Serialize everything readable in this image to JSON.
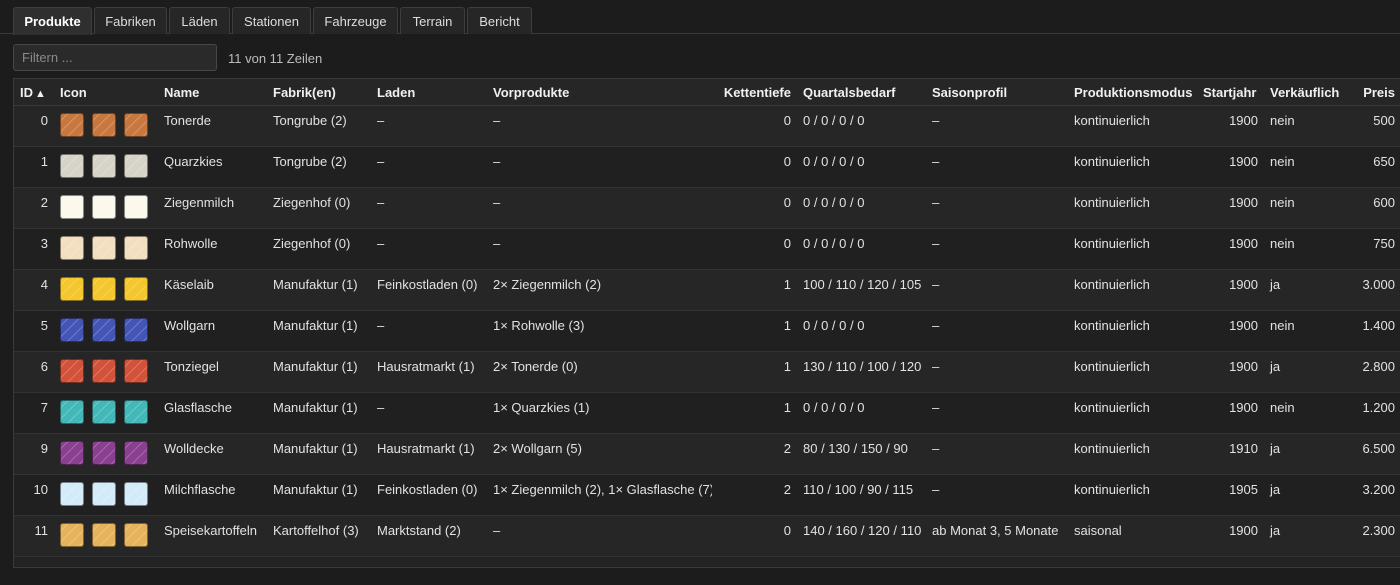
{
  "tabs": [
    {
      "label": "Produkte",
      "active": true
    },
    {
      "label": "Fabriken",
      "active": false
    },
    {
      "label": "Läden",
      "active": false
    },
    {
      "label": "Stationen",
      "active": false
    },
    {
      "label": "Fahrzeuge",
      "active": false
    },
    {
      "label": "Terrain",
      "active": false
    },
    {
      "label": "Bericht",
      "active": false
    }
  ],
  "filter": {
    "placeholder": "Filtern ...",
    "value": ""
  },
  "row_count": "11 von 11 Zeilen",
  "table": {
    "sort_indicator": "▲",
    "columns": [
      "ID",
      "Icon",
      "Name",
      "Fabrik(en)",
      "Laden",
      "Vorprodukte",
      "Kettentiefe",
      "Quartalsbedarf",
      "Saisonprofil",
      "Produktionsmodus",
      "Startjahr",
      "Verkäuflich",
      "Preis"
    ],
    "rows": [
      {
        "id": "0",
        "color": "#c8773f",
        "name": "Tonerde",
        "fabrik": "Tongrube (2)",
        "laden": "–",
        "vorprodukte": "–",
        "kettentiefe": "0",
        "quartalsbedarf": "0 / 0 / 0 / 0",
        "saisonprofil": "–",
        "modus": "kontinuierlich",
        "startjahr": "1900",
        "verkaeuflich": "nein",
        "preis": "500"
      },
      {
        "id": "1",
        "color": "#d6d3c8",
        "name": "Quarzkies",
        "fabrik": "Tongrube (2)",
        "laden": "–",
        "vorprodukte": "–",
        "kettentiefe": "0",
        "quartalsbedarf": "0 / 0 / 0 / 0",
        "saisonprofil": "–",
        "modus": "kontinuierlich",
        "startjahr": "1900",
        "verkaeuflich": "nein",
        "preis": "650"
      },
      {
        "id": "2",
        "color": "#fbf8ec",
        "name": "Ziegenmilch",
        "fabrik": "Ziegenhof (0)",
        "laden": "–",
        "vorprodukte": "–",
        "kettentiefe": "0",
        "quartalsbedarf": "0 / 0 / 0 / 0",
        "saisonprofil": "–",
        "modus": "kontinuierlich",
        "startjahr": "1900",
        "verkaeuflich": "nein",
        "preis": "600"
      },
      {
        "id": "3",
        "color": "#f2dfbf",
        "name": "Rohwolle",
        "fabrik": "Ziegenhof (0)",
        "laden": "–",
        "vorprodukte": "–",
        "kettentiefe": "0",
        "quartalsbedarf": "0 / 0 / 0 / 0",
        "saisonprofil": "–",
        "modus": "kontinuierlich",
        "startjahr": "1900",
        "verkaeuflich": "nein",
        "preis": "750"
      },
      {
        "id": "4",
        "color": "#f4c72e",
        "name": "Käselaib",
        "fabrik": "Manufaktur (1)",
        "laden": "Feinkostladen (0)",
        "vorprodukte": "2× Ziegenmilch (2)",
        "kettentiefe": "1",
        "quartalsbedarf": "100 / 110 / 120 / 105",
        "saisonprofil": "–",
        "modus": "kontinuierlich",
        "startjahr": "1900",
        "verkaeuflich": "ja",
        "preis": "3.000"
      },
      {
        "id": "5",
        "color": "#4455b8",
        "name": "Wollgarn",
        "fabrik": "Manufaktur (1)",
        "laden": "–",
        "vorprodukte": "1× Rohwolle (3)",
        "kettentiefe": "1",
        "quartalsbedarf": "0 / 0 / 0 / 0",
        "saisonprofil": "–",
        "modus": "kontinuierlich",
        "startjahr": "1900",
        "verkaeuflich": "nein",
        "preis": "1.400"
      },
      {
        "id": "6",
        "color": "#d2523a",
        "name": "Tonziegel",
        "fabrik": "Manufaktur (1)",
        "laden": "Hausratmarkt (1)",
        "vorprodukte": "2× Tonerde (0)",
        "kettentiefe": "1",
        "quartalsbedarf": "130 / 110 / 100 / 120",
        "saisonprofil": "–",
        "modus": "kontinuierlich",
        "startjahr": "1900",
        "verkaeuflich": "ja",
        "preis": "2.800"
      },
      {
        "id": "7",
        "color": "#43b8b8",
        "name": "Glasflasche",
        "fabrik": "Manufaktur (1)",
        "laden": "–",
        "vorprodukte": "1× Quarzkies (1)",
        "kettentiefe": "1",
        "quartalsbedarf": "0 / 0 / 0 / 0",
        "saisonprofil": "–",
        "modus": "kontinuierlich",
        "startjahr": "1900",
        "verkaeuflich": "nein",
        "preis": "1.200"
      },
      {
        "id": "9",
        "color": "#8a3f8f",
        "name": "Wolldecke",
        "fabrik": "Manufaktur (1)",
        "laden": "Hausratmarkt (1)",
        "vorprodukte": "2× Wollgarn (5)",
        "kettentiefe": "2",
        "quartalsbedarf": "80 / 130 / 150 / 90",
        "saisonprofil": "–",
        "modus": "kontinuierlich",
        "startjahr": "1910",
        "verkaeuflich": "ja",
        "preis": "6.500"
      },
      {
        "id": "10",
        "color": "#d3eaf8",
        "name": "Milchflasche",
        "fabrik": "Manufaktur (1)",
        "laden": "Feinkostladen (0)",
        "vorprodukte": "1× Ziegenmilch (2), 1× Glasflasche (7)",
        "kettentiefe": "2",
        "quartalsbedarf": "110 / 100 / 90 / 115",
        "saisonprofil": "–",
        "modus": "kontinuierlich",
        "startjahr": "1905",
        "verkaeuflich": "ja",
        "preis": "3.200"
      },
      {
        "id": "11",
        "color": "#e6b35c",
        "name": "Speisekartoffeln",
        "fabrik": "Kartoffelhof (3)",
        "laden": "Marktstand (2)",
        "vorprodukte": "–",
        "kettentiefe": "0",
        "quartalsbedarf": "140 / 160 / 120 / 110",
        "saisonprofil": "ab Monat 3, 5 Monate",
        "modus": "saisonal",
        "startjahr": "1900",
        "verkaeuflich": "ja",
        "preis": "2.300"
      }
    ]
  }
}
